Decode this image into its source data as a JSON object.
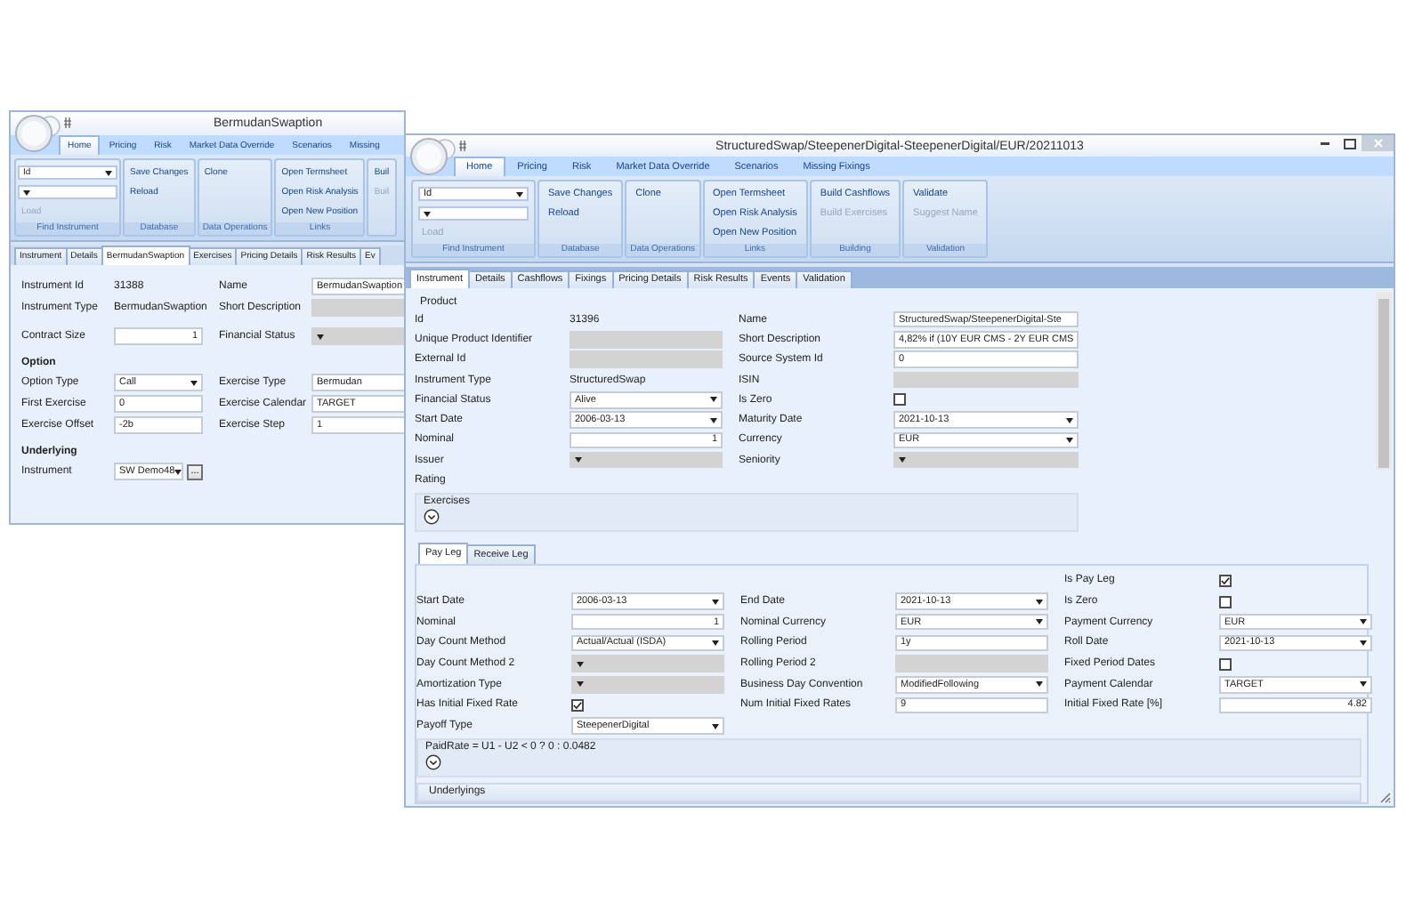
{
  "windows": [
    {
      "title": "BermudanSwaption",
      "window_buttons": false,
      "scrollable": false,
      "ribbon_tabs": [
        {
          "label": "Home",
          "selected": true
        },
        {
          "label": "Pricing",
          "selected": false
        },
        {
          "label": "Risk",
          "selected": false
        },
        {
          "label": "Market Data Override",
          "selected": false
        },
        {
          "label": "Scenarios",
          "selected": false
        },
        {
          "label": "Missing",
          "selected": false
        }
      ],
      "ribbon_groups": [
        {
          "label": "Find Instrument",
          "items": [
            {
              "kind": "dropdown",
              "value": "Id"
            },
            {
              "kind": "dropdown"
            },
            {
              "kind": "button",
              "label": "Load",
              "disabled": true
            }
          ]
        },
        {
          "label": "Database",
          "items": [
            {
              "kind": "button",
              "label": "Save Changes",
              "disabled": false
            },
            {
              "kind": "button",
              "label": "Reload",
              "disabled": false
            }
          ]
        },
        {
          "label": "Data Operations",
          "items": [
            {
              "kind": "button",
              "label": "Clone",
              "disabled": false
            }
          ]
        },
        {
          "label": "Links",
          "items": [
            {
              "kind": "button",
              "label": "Open Termsheet",
              "disabled": false
            },
            {
              "kind": "button",
              "label": "Open Risk Analysis",
              "disabled": false
            },
            {
              "kind": "button",
              "label": "Open New Position",
              "disabled": false
            }
          ]
        },
        {
          "items": [
            {
              "kind": "button",
              "label": "Buil",
              "disabled": false
            },
            {
              "kind": "button",
              "label": "Buil",
              "disabled": true
            }
          ]
        }
      ],
      "tabs": [
        {
          "label": "Instrument",
          "selected": false
        },
        {
          "label": "Details",
          "selected": false
        },
        {
          "label": "BermudanSwaption",
          "selected": true
        },
        {
          "label": "Exercises",
          "selected": false
        },
        {
          "label": "Pricing Details",
          "selected": false
        },
        {
          "label": "Risk Results",
          "selected": false
        },
        {
          "label": "Ev",
          "selected": false
        }
      ],
      "body": [
        {
          "kind": "fields",
          "rows": [
            {
              "column_1": {
                "label": "Instrument Id",
                "control": {
                  "kind": "text",
                  "value": "31388"
                }
              },
              "column_2": {
                "label": "Name",
                "control": {
                  "kind": "input",
                  "value": "BermudanSwaption",
                  "disabled": false
                }
              }
            },
            {
              "column_1": {
                "label": "Instrument Type",
                "control": {
                  "kind": "text",
                  "value": "BermudanSwaption"
                }
              },
              "column_2": {
                "label": "Short Description",
                "control": {
                  "kind": "input",
                  "disabled": true
                }
              }
            }
          ]
        },
        {
          "kind": "fields",
          "rows": [
            {
              "column_1": {
                "label": "Contract Size",
                "control": {
                  "kind": "number",
                  "value": "1",
                  "disabled": false
                }
              },
              "column_2": {
                "label": "Financial Status",
                "control": {
                  "kind": "dropdown",
                  "disabled": true
                }
              }
            }
          ]
        },
        {
          "kind": "heading",
          "label": "Option"
        },
        {
          "kind": "fields",
          "rows": [
            {
              "column_1": {
                "label": "Option Type",
                "control": {
                  "kind": "dropdown",
                  "value": "Call",
                  "disabled": false
                }
              },
              "column_2": {
                "label": "Exercise Type",
                "control": {
                  "kind": "dropdown",
                  "value": "Bermudan",
                  "disabled": false
                }
              }
            },
            {
              "column_1": {
                "label": "First Exercise",
                "control": {
                  "kind": "input",
                  "value": "0",
                  "disabled": false
                }
              },
              "column_2": {
                "label": "Exercise Calendar",
                "control": {
                  "kind": "dropdown",
                  "value": "TARGET",
                  "disabled": false
                }
              }
            },
            {
              "column_1": {
                "label": "Exercise Offset",
                "control": {
                  "kind": "input",
                  "value": "-2b",
                  "disabled": false
                }
              },
              "column_2": {
                "label": "Exercise Step",
                "control": {
                  "kind": "input",
                  "value": "1",
                  "disabled": false
                }
              }
            }
          ]
        },
        {
          "kind": "heading",
          "label": "Underlying"
        },
        {
          "kind": "fields",
          "rows": [
            {
              "column_1": {
                "label": "Instrument",
                "control": {
                  "kind": "dropdown",
                  "value": "SW Demo48",
                  "disabled": false
                },
                "button": "..."
              }
            }
          ]
        }
      ]
    },
    {
      "title": "StructuredSwap/SteepenerDigital-SteepenerDigital/EUR/20211013",
      "window_buttons": true,
      "scrollable": true,
      "ribbon_tabs": [
        {
          "label": "Home",
          "selected": true
        },
        {
          "label": "Pricing",
          "selected": false
        },
        {
          "label": "Risk",
          "selected": false
        },
        {
          "label": "Market Data Override",
          "selected": false
        },
        {
          "label": "Scenarios",
          "selected": false
        },
        {
          "label": "Missing Fixings",
          "selected": false
        }
      ],
      "ribbon_groups": [
        {
          "label": "Find Instrument",
          "items": [
            {
              "kind": "dropdown",
              "value": "Id"
            },
            {
              "kind": "dropdown"
            },
            {
              "kind": "button",
              "label": "Load",
              "disabled": true
            }
          ]
        },
        {
          "label": "Database",
          "items": [
            {
              "kind": "button",
              "label": "Save Changes",
              "disabled": false
            },
            {
              "kind": "button",
              "label": "Reload",
              "disabled": false
            }
          ]
        },
        {
          "label": "Data Operations",
          "items": [
            {
              "kind": "button",
              "label": "Clone",
              "disabled": false
            }
          ]
        },
        {
          "label": "Links",
          "items": [
            {
              "kind": "button",
              "label": "Open Termsheet",
              "disabled": false
            },
            {
              "kind": "button",
              "label": "Open Risk Analysis",
              "disabled": false
            },
            {
              "kind": "button",
              "label": "Open New Position",
              "disabled": false
            }
          ]
        },
        {
          "label": "Building",
          "items": [
            {
              "kind": "button",
              "label": "Build Cashflows",
              "disabled": false
            },
            {
              "kind": "button",
              "label": "Build Exercises",
              "disabled": true
            }
          ]
        },
        {
          "label": "Validation",
          "items": [
            {
              "kind": "button",
              "label": "Validate",
              "disabled": false
            },
            {
              "kind": "button",
              "label": "Suggest Name",
              "disabled": true
            }
          ]
        }
      ],
      "tabs": [
        {
          "label": "Instrument",
          "selected": true
        },
        {
          "label": "Details",
          "selected": false
        },
        {
          "label": "Cashflows",
          "selected": false
        },
        {
          "label": "Fixings",
          "selected": false
        },
        {
          "label": "Pricing Details",
          "selected": false
        },
        {
          "label": "Risk Results",
          "selected": false
        },
        {
          "label": "Events",
          "selected": false
        },
        {
          "label": "Validation",
          "selected": false
        }
      ],
      "body": [
        {
          "kind": "group_label",
          "label": "Product"
        },
        {
          "kind": "fields",
          "rows": [
            {
              "column_1": {
                "label": "Id",
                "control": {
                  "kind": "text",
                  "value": "31396"
                }
              },
              "column_2": {
                "label": "Name",
                "control": {
                  "kind": "input",
                  "value": "StructuredSwap/SteepenerDigital-Ste",
                  "disabled": false
                }
              }
            },
            {
              "column_1": {
                "label": "Unique Product Identifier",
                "control": {
                  "kind": "input",
                  "disabled": true
                }
              },
              "column_2": {
                "label": "Short Description",
                "control": {
                  "kind": "input",
                  "value": "4,82% if (10Y EUR CMS - 2Y EUR CMS",
                  "disabled": false
                }
              }
            },
            {
              "column_1": {
                "label": "External Id",
                "control": {
                  "kind": "input",
                  "disabled": true
                }
              },
              "column_2": {
                "label": "Source System Id",
                "control": {
                  "kind": "input",
                  "value": "0",
                  "disabled": false
                }
              }
            },
            {
              "column_1": {
                "label": "Instrument Type",
                "control": {
                  "kind": "text",
                  "value": "StructuredSwap"
                }
              },
              "column_2": {
                "label": "ISIN",
                "control": {
                  "kind": "input",
                  "disabled": true
                }
              }
            },
            {
              "column_1": {
                "label": "Financial Status",
                "control": {
                  "kind": "dropdown",
                  "value": "Alive",
                  "disabled": false
                }
              },
              "column_2": {
                "label": "Is Zero",
                "control": {
                  "kind": "checkbox",
                  "checked": false
                }
              }
            },
            {
              "column_1": {
                "label": "Start Date",
                "control": {
                  "kind": "dropdown",
                  "value": "2006-03-13",
                  "disabled": false
                }
              },
              "column_2": {
                "label": "Maturity Date",
                "control": {
                  "kind": "dropdown",
                  "value": "2021-10-13",
                  "disabled": false
                }
              }
            },
            {
              "column_1": {
                "label": "Nominal",
                "control": {
                  "kind": "number",
                  "value": "1",
                  "disabled": false
                }
              },
              "column_2": {
                "label": "Currency",
                "control": {
                  "kind": "dropdown",
                  "value": "EUR",
                  "disabled": false
                }
              }
            },
            {
              "column_1": {
                "label": "Issuer",
                "control": {
                  "kind": "dropdown",
                  "disabled": true
                }
              },
              "column_2": {
                "label": "Seniority",
                "control": {
                  "kind": "dropdown",
                  "disabled": true
                }
              }
            },
            {
              "column_1": {
                "label": "Rating"
              }
            }
          ]
        },
        {
          "kind": "expander",
          "label": "Exercises"
        },
        {
          "kind": "tabs",
          "tabs": [
            {
              "label": "Pay Leg",
              "selected": true
            },
            {
              "label": "Receive Leg",
              "selected": false
            }
          ],
          "content": [
            {
              "kind": "fields",
              "rows": [
                {
                  "column_3": {
                    "label": "Is Pay Leg",
                    "control": {
                      "kind": "checkbox",
                      "checked": true
                    }
                  }
                },
                {
                  "column_1": {
                    "label": "Start Date",
                    "control": {
                      "kind": "dropdown",
                      "value": "2006-03-13",
                      "disabled": false
                    }
                  },
                  "column_2": {
                    "label": "End Date",
                    "control": {
                      "kind": "dropdown",
                      "value": "2021-10-13",
                      "disabled": false
                    }
                  },
                  "column_3": {
                    "label": "Is Zero",
                    "control": {
                      "kind": "checkbox",
                      "checked": false
                    }
                  }
                },
                {
                  "column_1": {
                    "label": "Nominal",
                    "control": {
                      "kind": "number",
                      "value": "1",
                      "disabled": false
                    }
                  },
                  "column_2": {
                    "label": "Nominal Currency",
                    "control": {
                      "kind": "dropdown",
                      "value": "EUR",
                      "disabled": false
                    }
                  },
                  "column_3": {
                    "label": "Payment Currency",
                    "control": {
                      "kind": "dropdown",
                      "value": "EUR",
                      "disabled": false
                    }
                  }
                },
                {
                  "column_1": {
                    "label": "Day Count Method",
                    "control": {
                      "kind": "dropdown",
                      "value": "Actual/Actual (ISDA)",
                      "disabled": false
                    }
                  },
                  "column_2": {
                    "label": "Rolling Period",
                    "control": {
                      "kind": "input",
                      "value": "1y",
                      "disabled": false
                    }
                  },
                  "column_3": {
                    "label": "Roll Date",
                    "control": {
                      "kind": "dropdown",
                      "value": "2021-10-13",
                      "disabled": false
                    }
                  }
                },
                {
                  "column_1": {
                    "label": "Day Count Method 2",
                    "control": {
                      "kind": "dropdown",
                      "disabled": true
                    }
                  },
                  "column_2": {
                    "label": "Rolling Period 2",
                    "control": {
                      "kind": "input",
                      "disabled": true
                    }
                  },
                  "column_3": {
                    "label": "Fixed Period Dates",
                    "control": {
                      "kind": "checkbox",
                      "checked": false
                    }
                  }
                },
                {
                  "column_1": {
                    "label": "Amortization Type",
                    "control": {
                      "kind": "dropdown",
                      "disabled": true
                    }
                  },
                  "column_2": {
                    "label": "Business Day Convention",
                    "control": {
                      "kind": "dropdown",
                      "value": "ModifiedFollowing",
                      "disabled": false
                    }
                  },
                  "column_3": {
                    "label": "Payment Calendar",
                    "control": {
                      "kind": "dropdown",
                      "value": "TARGET",
                      "disabled": false
                    }
                  }
                },
                {
                  "column_1": {
                    "label": "Has Initial Fixed Rate",
                    "control": {
                      "kind": "checkbox",
                      "checked": true
                    }
                  },
                  "column_2": {
                    "label": "Num Initial Fixed Rates",
                    "control": {
                      "kind": "input",
                      "value": "9",
                      "disabled": false
                    }
                  },
                  "column_3": {
                    "label": "Initial Fixed Rate [%]",
                    "control": {
                      "kind": "number",
                      "value": "4.82",
                      "disabled": false
                    }
                  }
                },
                {
                  "column_1": {
                    "label": "Payoff Type",
                    "control": {
                      "kind": "dropdown",
                      "value": "SteepenerDigital",
                      "disabled": false
                    }
                  }
                }
              ]
            },
            {
              "kind": "expander",
              "label": "PaidRate = U1 - U2 < 0 ? 0 : 0.0482"
            },
            {
              "kind": "group_header",
              "label": "Underlyings"
            }
          ]
        }
      ]
    }
  ]
}
